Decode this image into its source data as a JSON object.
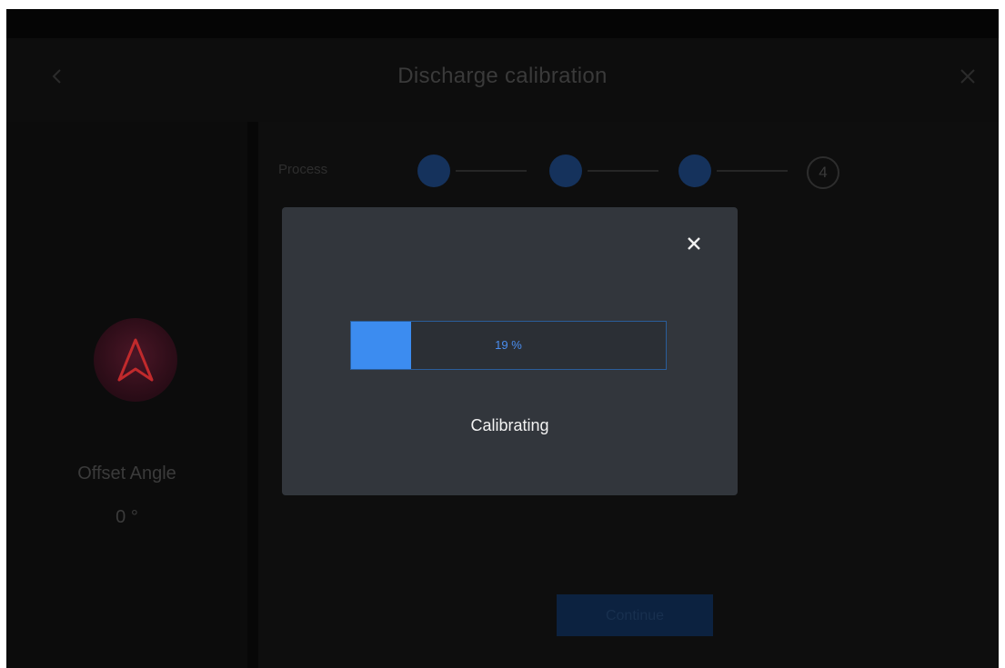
{
  "header": {
    "title": "Discharge calibration",
    "back_icon": "chevron-left-icon",
    "close_icon": "close-icon"
  },
  "left_panel": {
    "compass_icon": "compass-arrow-icon",
    "offset_label": "Offset Angle",
    "offset_value": "0 °"
  },
  "steps": {
    "label": "Process",
    "items": [
      {
        "state": "done"
      },
      {
        "state": "done"
      },
      {
        "state": "done"
      },
      {
        "state": "pending",
        "number": "4"
      }
    ]
  },
  "next_button": {
    "label": "Continue"
  },
  "modal": {
    "close_icon": "close-icon",
    "progress_percent": 19,
    "progress_text": "19 %",
    "status": "Calibrating"
  },
  "colors": {
    "accent": "#3c8cf0",
    "modal_bg": "#32363c",
    "compass_arrow": "#d2302e"
  }
}
